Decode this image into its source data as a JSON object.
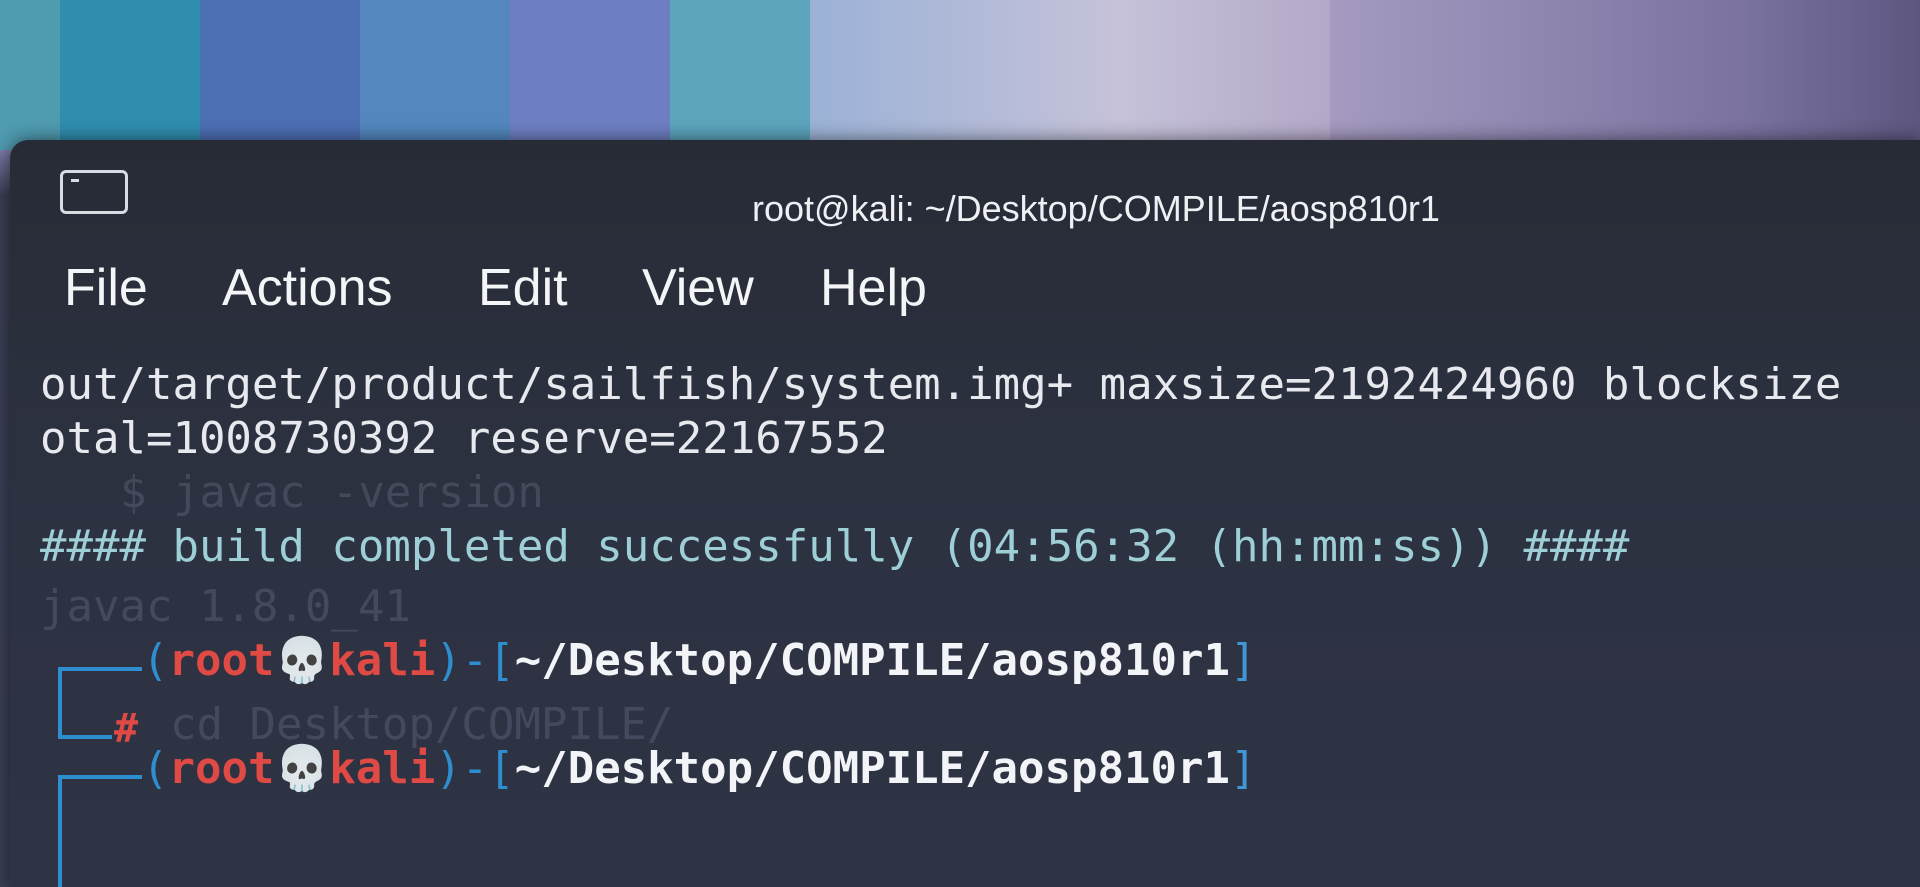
{
  "window": {
    "title": "root@kali: ~/Desktop/COMPILE/aosp810r1"
  },
  "menu": {
    "file": "File",
    "actions": "Actions",
    "edit": "Edit",
    "view": "View",
    "help": "Help"
  },
  "terminal": {
    "output_line_1": "out/target/product/sailfish/system.img+ maxsize=2192424960 blocksize",
    "output_line_2": "otal=1008730392 reserve=22167552",
    "ghost_line_1": "$ javac -version",
    "success_line": "#### build completed successfully (04:56:32 (hh:mm:ss)) ####",
    "ghost_line_2": "javac 1.8.0_41",
    "ghost_line_3": "cd Desktop/COMPILE/",
    "prompt": {
      "open": "(",
      "user": "root",
      "skull": "💀",
      "host": "kali",
      "close": ")-[",
      "cwd": "~/Desktop/COMPILE/aosp810r1",
      "end": "]",
      "hash": "#"
    }
  },
  "colors": {
    "prompt_user": "#e04a44",
    "prompt_frame": "#2f8ecf",
    "success_text": "#9ecfd6",
    "terminal_bg": "#2c3140"
  },
  "icons": [
    "window-icon",
    "skull-icon"
  ]
}
